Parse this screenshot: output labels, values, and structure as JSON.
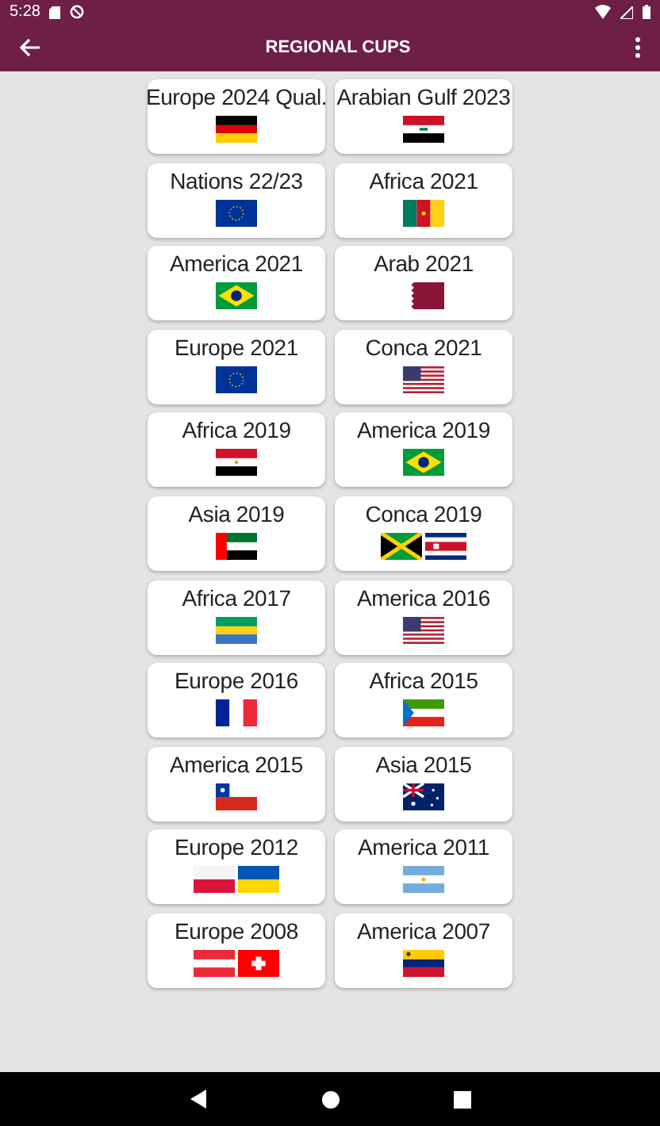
{
  "status_bar": {
    "time": "5:28"
  },
  "app_bar": {
    "title": "REGIONAL CUPS"
  },
  "cups": [
    {
      "label": "Europe 2024 Qual.",
      "flags": [
        {
          "kind": "germany"
        }
      ]
    },
    {
      "label": "Arabian Gulf 2023",
      "flags": [
        {
          "kind": "iraq"
        }
      ]
    },
    {
      "label": "Nations 22/23",
      "flags": [
        {
          "kind": "eu"
        }
      ]
    },
    {
      "label": "Africa 2021",
      "flags": [
        {
          "kind": "cameroon"
        }
      ]
    },
    {
      "label": "America 2021",
      "flags": [
        {
          "kind": "brazil"
        }
      ]
    },
    {
      "label": "Arab 2021",
      "flags": [
        {
          "kind": "qatar"
        }
      ]
    },
    {
      "label": "Europe 2021",
      "flags": [
        {
          "kind": "eu"
        }
      ]
    },
    {
      "label": "Conca 2021",
      "flags": [
        {
          "kind": "usa"
        }
      ]
    },
    {
      "label": "Africa 2019",
      "flags": [
        {
          "kind": "egypt"
        }
      ]
    },
    {
      "label": "America 2019",
      "flags": [
        {
          "kind": "brazil"
        }
      ]
    },
    {
      "label": "Asia 2019",
      "flags": [
        {
          "kind": "uae"
        }
      ]
    },
    {
      "label": "Conca 2019",
      "flags": [
        {
          "kind": "jamaica"
        },
        {
          "kind": "costarica"
        }
      ]
    },
    {
      "label": "Africa 2017",
      "flags": [
        {
          "kind": "gabon"
        }
      ]
    },
    {
      "label": "America 2016",
      "flags": [
        {
          "kind": "usa"
        }
      ]
    },
    {
      "label": "Europe 2016",
      "flags": [
        {
          "kind": "france"
        }
      ]
    },
    {
      "label": "Africa 2015",
      "flags": [
        {
          "kind": "eqguinea"
        }
      ]
    },
    {
      "label": "America 2015",
      "flags": [
        {
          "kind": "chile"
        }
      ]
    },
    {
      "label": "Asia 2015",
      "flags": [
        {
          "kind": "australia"
        }
      ]
    },
    {
      "label": "Europe 2012",
      "flags": [
        {
          "kind": "poland"
        },
        {
          "kind": "ukraine"
        }
      ]
    },
    {
      "label": "America 2011",
      "flags": [
        {
          "kind": "argentina"
        }
      ]
    },
    {
      "label": "Europe 2008",
      "flags": [
        {
          "kind": "austria"
        },
        {
          "kind": "switzerland"
        }
      ]
    },
    {
      "label": "America 2007",
      "flags": [
        {
          "kind": "venezuela"
        }
      ]
    }
  ]
}
